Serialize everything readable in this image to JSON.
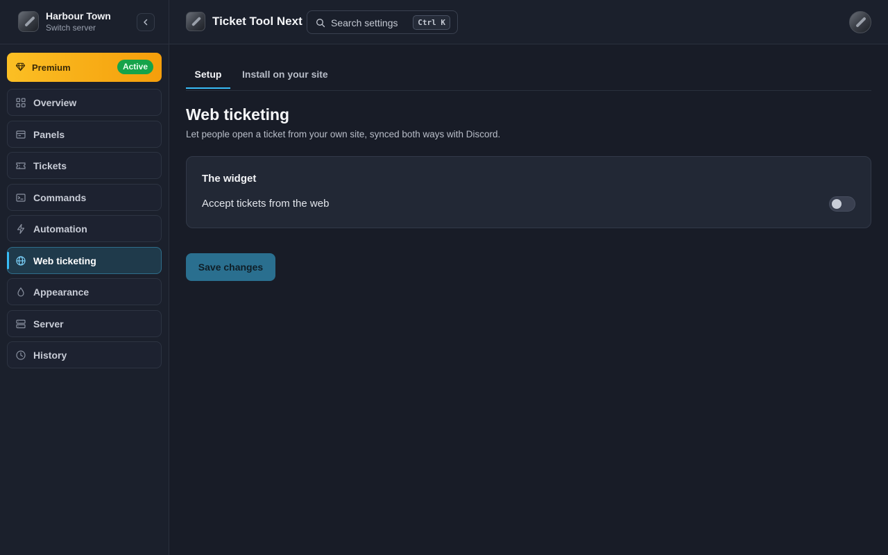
{
  "server": {
    "name": "Harbour Town",
    "subtitle": "Switch server"
  },
  "premium": {
    "label": "Premium",
    "badge": "Active"
  },
  "sidebar": {
    "items": [
      {
        "label": "Overview",
        "icon": "grid-icon"
      },
      {
        "label": "Panels",
        "icon": "panel-icon"
      },
      {
        "label": "Tickets",
        "icon": "ticket-icon"
      },
      {
        "label": "Commands",
        "icon": "terminal-icon"
      },
      {
        "label": "Automation",
        "icon": "bolt-icon"
      },
      {
        "label": "Web ticketing",
        "icon": "globe-icon",
        "active": true
      },
      {
        "label": "Appearance",
        "icon": "droplet-icon"
      },
      {
        "label": "Server",
        "icon": "server-icon"
      },
      {
        "label": "History",
        "icon": "clock-icon"
      }
    ]
  },
  "topbar": {
    "app_title": "Ticket Tool Next",
    "search_placeholder": "Search settings",
    "shortcut": "Ctrl K"
  },
  "tabs": [
    {
      "label": "Setup",
      "active": true
    },
    {
      "label": "Install on your site",
      "active": false
    }
  ],
  "page": {
    "title": "Web ticketing",
    "description": "Let people open a ticket from your own site, synced both ways with Discord."
  },
  "widget_card": {
    "title": "The widget",
    "toggle_label": "Accept tickets from the web",
    "toggle_on": false
  },
  "actions": {
    "save_label": "Save changes"
  },
  "colors": {
    "accent": "#38bdf8",
    "premium": "#f59e0b",
    "badge": "#16a34a",
    "save_button": "#2a6f8f"
  }
}
